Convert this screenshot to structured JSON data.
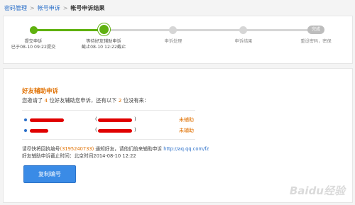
{
  "breadcrumb": {
    "items": [
      "密码管理",
      "帐号申诉"
    ],
    "current": "帐号申诉结果"
  },
  "progress": {
    "steps": [
      {
        "label": "提交申诉",
        "sub": "已于08-10  09:22提交",
        "state": "done"
      },
      {
        "label": "等待好友辅助申诉",
        "sub": "截止08-10  12:22截止",
        "state": "active"
      },
      {
        "label": "申诉处理",
        "sub": "",
        "state": "pending"
      },
      {
        "label": "申诉结果",
        "sub": "",
        "state": "pending"
      },
      {
        "label": "重设密码，密保",
        "sub": "",
        "state": "pending",
        "pill": "完成"
      }
    ],
    "colors": {
      "done": "#5fb10f",
      "pending": "#d6d6d6"
    }
  },
  "main": {
    "title": "好友辅助申诉",
    "invite_prefix": "您邀请了",
    "invite_count": "4",
    "invite_mid": "位好友辅助您申诉，还有以下",
    "remaining_count": "2",
    "invite_suffix": "位没有来：",
    "friends": [
      {
        "open_paren": "(",
        "close_paren": ")",
        "status": "未辅助"
      },
      {
        "open_paren": "(",
        "close_paren": ")",
        "status": "未辅助"
      }
    ],
    "notice_prefix": "请尽快将回执编号",
    "receipt": "(3195240733)",
    "notice_mid": "通知好友，请他们前来辅助申诉",
    "notice_link": "http://aq.qq.com/fz",
    "deadline": "好友辅助申诉截止时间：北京时间2014-08-10  12:22",
    "copy_button": "复制编号"
  },
  "watermark": "Baidu经验"
}
